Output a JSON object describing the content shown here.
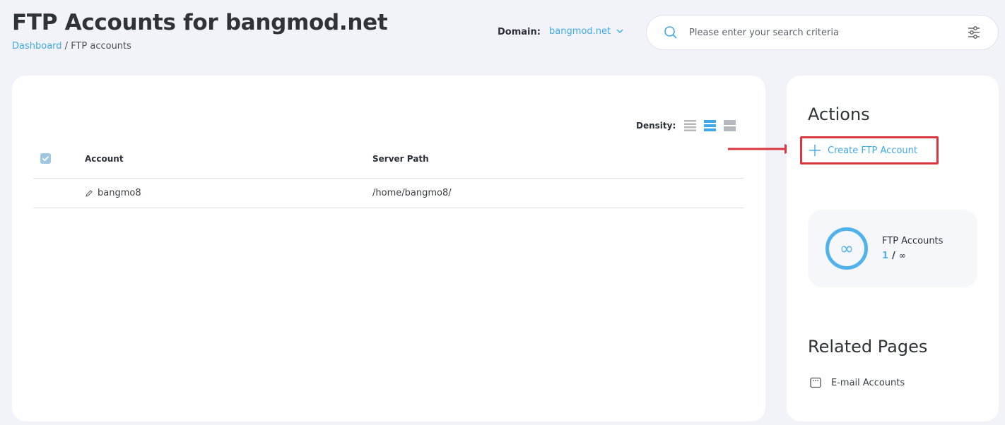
{
  "header": {
    "title": "FTP Accounts for bangmod.net",
    "breadcrumb": {
      "home": "Dashboard",
      "separator": " / ",
      "current": "FTP accounts"
    },
    "domain_label": "Domain:",
    "domain_value": "bangmod.net"
  },
  "search": {
    "placeholder": "Please enter your search criteria",
    "value": ""
  },
  "table": {
    "density_label": "Density:",
    "columns": {
      "account": "Account",
      "path": "Server Path"
    },
    "rows": [
      {
        "account": "bangmo8",
        "path": "/home/bangmo8/"
      }
    ]
  },
  "sidebar": {
    "actions_title": "Actions",
    "create_label": "Create FTP Account",
    "stats": {
      "label": "FTP Accounts",
      "used": "1",
      "separator": "/",
      "limit": "∞",
      "ring_symbol": "∞"
    },
    "related_title": "Related Pages",
    "related_items": [
      {
        "label": "E-mail Accounts"
      }
    ]
  },
  "colors": {
    "accent": "#3fa9e8",
    "highlight": "#d9363e",
    "background": "#f1f3f8"
  }
}
